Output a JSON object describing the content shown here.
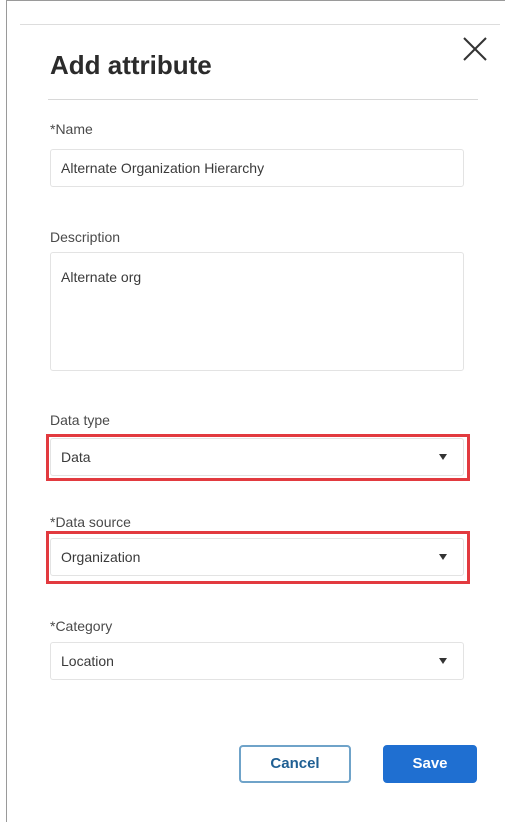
{
  "dialog": {
    "title": "Add attribute",
    "close_icon": "close-icon"
  },
  "fields": {
    "name": {
      "label": "*Name",
      "value": "Alternate Organization Hierarchy"
    },
    "description": {
      "label": "Description",
      "value": "Alternate org"
    },
    "data_type": {
      "label": "Data type",
      "value": "Data"
    },
    "data_source": {
      "label": "*Data source",
      "value": "Organization"
    },
    "category": {
      "label": "*Category",
      "value": "Location"
    }
  },
  "buttons": {
    "cancel": "Cancel",
    "save": "Save"
  },
  "colors": {
    "highlight": "#e23a3f",
    "primary": "#1f6fd1",
    "secondary_border": "#6fa3c9"
  }
}
